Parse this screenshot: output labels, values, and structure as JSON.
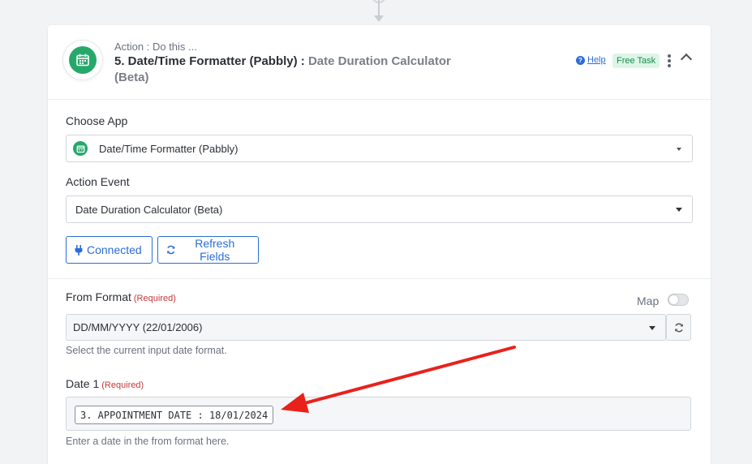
{
  "header": {
    "action_label": "Action : Do this ...",
    "step_name": "5. Date/Time Formatter (Pabbly) :",
    "event_name": "Date Duration Calculator (Beta)",
    "help_label": "Help",
    "free_task_label": "Free Task"
  },
  "choose_app": {
    "label": "Choose App",
    "value": "Date/Time Formatter (Pabbly)"
  },
  "action_event": {
    "label": "Action Event",
    "value": "Date Duration Calculator (Beta)"
  },
  "buttons": {
    "connected_label": "Connected",
    "refresh_fields_label": "Refresh Fields"
  },
  "from_format": {
    "label": "From Format",
    "required_label": "(Required)",
    "value": "DD/MM/YYYY (22/01/2006)",
    "helper": "Select the current input date format.",
    "map_label": "Map"
  },
  "date1": {
    "label": "Date 1",
    "required_label": "(Required)",
    "pill_value": "3. APPOINTMENT DATE : 18/01/2024",
    "helper": "Enter a date in the from format here."
  },
  "colors": {
    "accent": "#2a6dd9",
    "app_green": "#27a86b",
    "required": "#c53a3a",
    "annotation_arrow": "#e8221b"
  },
  "icons": [
    "calendar-icon",
    "help-icon",
    "kebab-menu-icon",
    "chevron-up-icon",
    "plug-icon",
    "refresh-icon",
    "dropdown-caret-icon",
    "toggle"
  ]
}
